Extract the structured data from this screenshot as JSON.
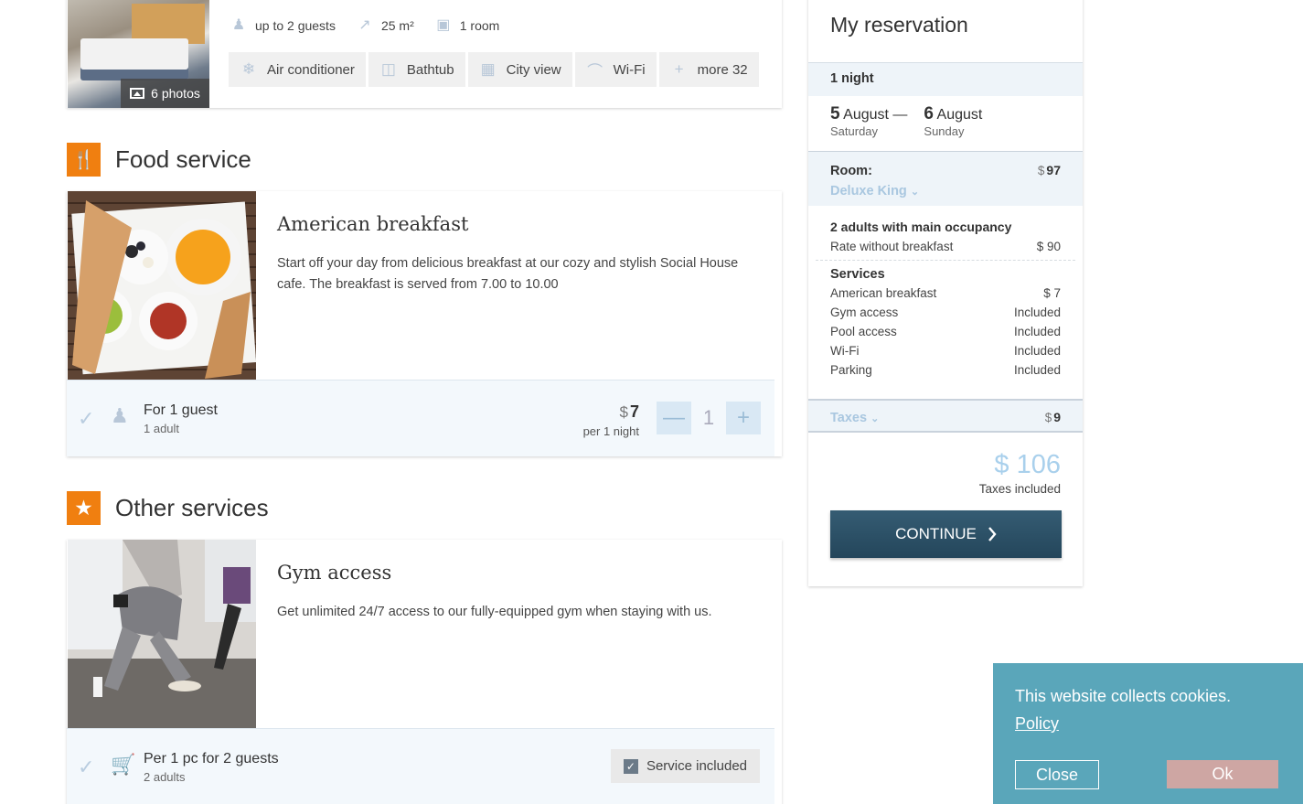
{
  "room": {
    "photos_label": "6 photos",
    "meta": [
      {
        "icon": "guests-icon",
        "text": "up to 2 guests"
      },
      {
        "icon": "area-icon",
        "text": "25 m²"
      },
      {
        "icon": "room-icon",
        "text": "1 room"
      }
    ],
    "amenities": [
      {
        "icon": "snowflake-icon",
        "label": "Air conditioner"
      },
      {
        "icon": "bathtub-icon",
        "label": "Bathtub"
      },
      {
        "icon": "city-view-icon",
        "label": "City view"
      },
      {
        "icon": "wifi-icon",
        "label": "Wi-Fi"
      },
      {
        "icon": "plus-icon",
        "label": "more 32"
      }
    ]
  },
  "food_section": {
    "title": "Food service",
    "icon": "fork-knife-icon"
  },
  "breakfast": {
    "name": "American breakfast",
    "description": "Start off your day from delicious breakfast at our cozy and stylish Social House cafe. The breakfast is served from 7.00 to 10.00",
    "for_main": "For 1 guest",
    "for_sub": "1 adult",
    "currency": "$",
    "price": "7",
    "price_sub": "per 1 night",
    "minus": "—",
    "quantity": "1",
    "plus": "+"
  },
  "other_section": {
    "title": "Other services",
    "icon": "star-icon"
  },
  "gym": {
    "name": "Gym access",
    "description": "Get unlimited 24/7 access to our fully-equipped gym when staying with us.",
    "for_main": "Per 1 pc for 2 guests",
    "for_sub": "2 adults",
    "included_label": "Service included"
  },
  "reservation": {
    "title": "My reservation",
    "nights": "1 night",
    "checkin_day": "5",
    "checkin_month": "August",
    "checkin_weekday": "Saturday",
    "separator": "—",
    "checkout_day": "6",
    "checkout_month": "August",
    "checkout_weekday": "Sunday",
    "room_label": "Room:",
    "currency": "$",
    "room_price": "97",
    "room_type": "Deluxe King",
    "occupancy": "2 adults with main occupancy",
    "rate_label": "Rate without breakfast",
    "rate_price": "$ 90",
    "services_title": "Services",
    "services": [
      {
        "name": "American breakfast",
        "value": "$ 7"
      },
      {
        "name": "Gym access",
        "value": "Included"
      },
      {
        "name": "Pool access",
        "value": "Included"
      },
      {
        "name": "Wi-Fi",
        "value": "Included"
      },
      {
        "name": "Parking",
        "value": "Included"
      }
    ],
    "taxes_label": "Taxes",
    "taxes_price": "9",
    "total": "$ 106",
    "total_sub": "Taxes included",
    "continue_label": "CONTINUE"
  },
  "cookie": {
    "text": "This website collects cookies.",
    "link": "Policy",
    "close": "Close",
    "ok": "Ok"
  },
  "colors": {
    "accent_orange": "#f07f10",
    "continue_button": "#2c5268",
    "cookie_banner": "#5aa6ba",
    "ok_button": "#cea6a3",
    "muted_blue": "#a9c7e0"
  }
}
